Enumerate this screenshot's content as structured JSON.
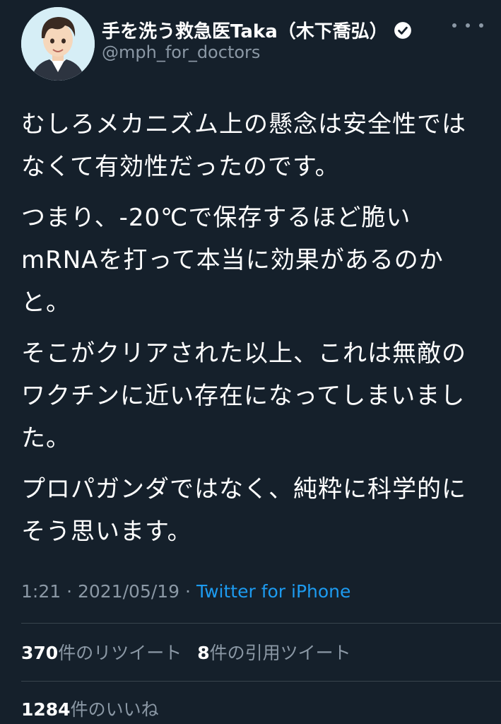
{
  "author": {
    "name": "手を洗う救急医Taka（木下喬弘）",
    "handle": "@mph_for_doctors",
    "verified": true
  },
  "tweet": {
    "paragraphs": [
      "むしろメカニズム上の懸念は安全性ではなくて有効性だったのです。",
      "つまり、-20℃で保存するほど脆いmRNAを打って本当に効果があるのかと。",
      "そこがクリアされた以上、これは無敵のワクチンに近い存在になってしまいました。",
      "プロパガンダではなく、純粋に科学的にそう思います。"
    ],
    "time": "1:21",
    "date": "2021/05/19",
    "separator": "·",
    "source": "Twitter for iPhone"
  },
  "stats": {
    "retweets_count": "370",
    "retweets_label": "件のリツイート",
    "quotes_count": "8",
    "quotes_label": "件の引用ツイート",
    "likes_count": "1284",
    "likes_label": "件のいいね"
  },
  "colors": {
    "background": "#15202b",
    "text": "#ffffff",
    "secondary": "#8b98a5",
    "link": "#1d9bf0",
    "divider": "#38444d"
  },
  "icons": {
    "verified": "verified-badge-icon",
    "more": "more-options-icon"
  }
}
